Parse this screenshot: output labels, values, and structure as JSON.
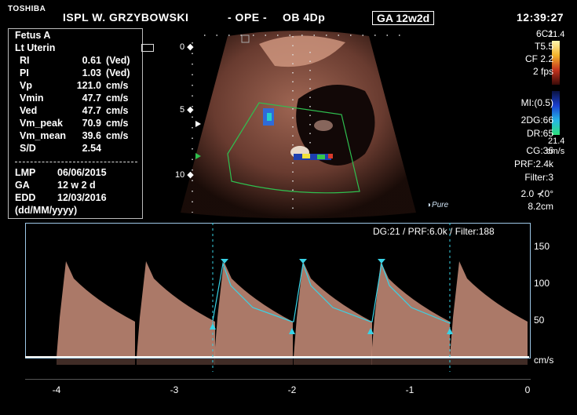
{
  "header": {
    "brand": "TOSHIBA",
    "institution": "ISPL W. GRZYBOWSKI",
    "mode": "- OPE -",
    "preset": "OB 4Dp",
    "ga_badge": "GA  12w2d",
    "time": "12:39:27"
  },
  "measurements": {
    "title1": "Fetus A",
    "title2": "Lt Uterin",
    "rows": [
      {
        "label": "RI",
        "value": "0.61",
        "unit": "(Ved)"
      },
      {
        "label": "PI",
        "value": "1.03",
        "unit": "(Ved)"
      },
      {
        "label": "Vp",
        "value": "121.0",
        "unit": "cm/s"
      },
      {
        "label": "Vmin",
        "value": "47.7",
        "unit": "cm/s"
      },
      {
        "label": "Ved",
        "value": "47.7",
        "unit": "cm/s"
      },
      {
        "label": "Vm_peak",
        "value": "70.9",
        "unit": "cm/s"
      },
      {
        "label": "Vm_mean",
        "value": "39.6",
        "unit": "cm/s"
      },
      {
        "label": "S/D",
        "value": "2.54",
        "unit": ""
      }
    ],
    "lmp_label": "LMP",
    "lmp_value": "06/06/2015",
    "ga_label": "GA",
    "ga_value": "12 w 2 d",
    "edd_label": "EDD",
    "edd_value": "12/03/2016",
    "date_format": "(dd/MM/yyyy)"
  },
  "params": {
    "probe": "6C1",
    "t": "T5.5",
    "cf": "CF 2.2",
    "fps": "2 fps",
    "mi": "MI:(0.5)",
    "dg2": "2DG:66",
    "dr": "DR:65",
    "cg": "CG:36",
    "prf": "PRF:2.4k",
    "filter": "Filter:3",
    "angle": "2.0  ⊀0°",
    "depth": "8.2cm",
    "scale_top": "21.4",
    "scale_bottom": "21.4",
    "scale_unit": "cm/s",
    "pure_logo": "Pure"
  },
  "depth_marks": [
    "0",
    "5",
    "10"
  ],
  "doppler": {
    "info": "DG:21 /   PRF:6.0k  / Filter:188",
    "y_ticks": [
      "150",
      "100",
      "50"
    ],
    "y_unit": "cm/s",
    "x_ticks": [
      "-4",
      "-3",
      "-2",
      "-1",
      "0"
    ]
  },
  "colors": {
    "accent_cyan": "#39d3e6",
    "border_blue": "#9ec8e8",
    "spectral": "#c98e7a"
  }
}
